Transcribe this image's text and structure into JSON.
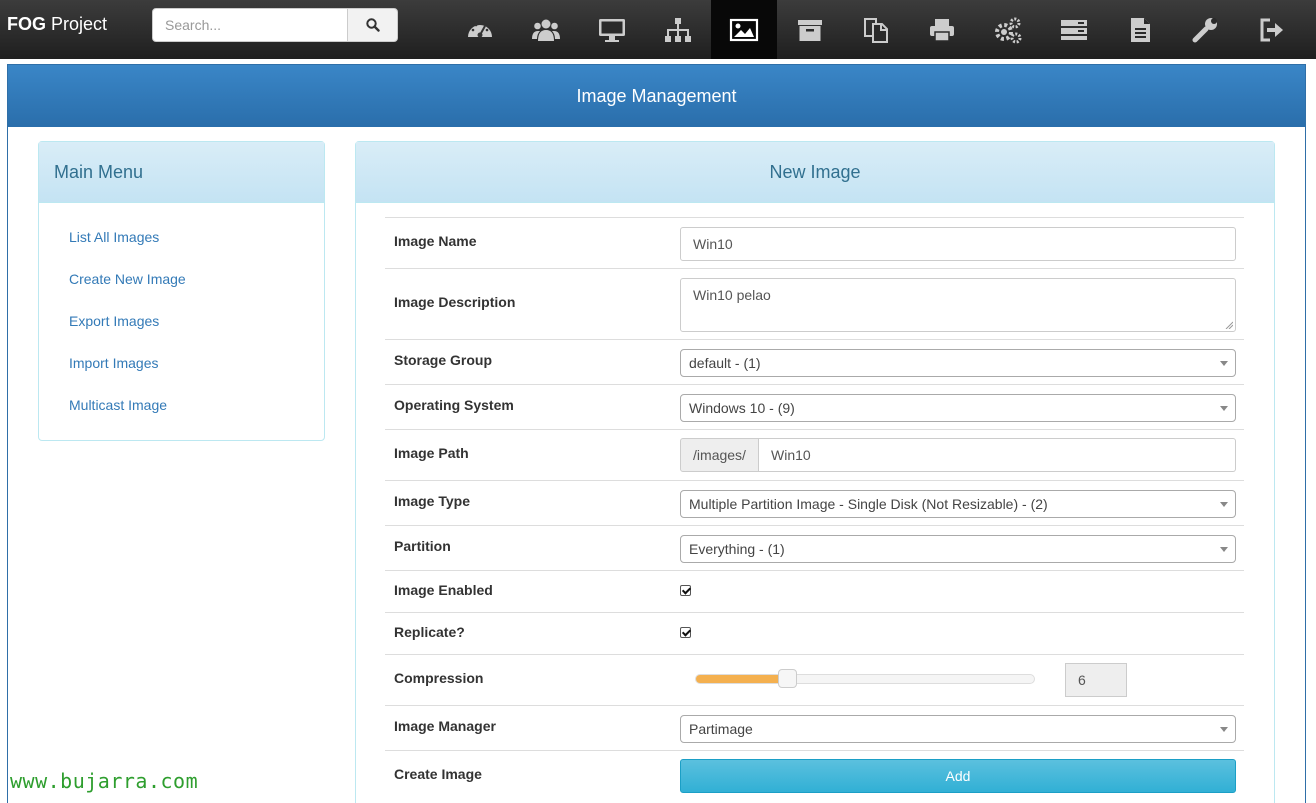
{
  "navbar": {
    "brand_bold": "FOG",
    "brand_rest": " Project",
    "search_placeholder": "Search...",
    "icons": [
      "dashboard-icon",
      "users-icon",
      "desktop-icon",
      "sitemap-icon",
      "image-icon",
      "archive-icon",
      "copy-icon",
      "print-icon",
      "cogs-icon",
      "server-icon",
      "file-icon",
      "wrench-icon",
      "logout-icon"
    ],
    "active_icon": "image-icon"
  },
  "page": {
    "title": "Image Management"
  },
  "menu": {
    "title": "Main Menu",
    "items": [
      "List All Images",
      "Create New Image",
      "Export Images",
      "Import Images",
      "Multicast Image"
    ]
  },
  "form": {
    "title": "New Image",
    "image_name": {
      "label": "Image Name",
      "value": "Win10"
    },
    "image_description": {
      "label": "Image Description",
      "value": "Win10 pelao"
    },
    "storage_group": {
      "label": "Storage Group",
      "value": "default - (1)"
    },
    "operating_system": {
      "label": "Operating System",
      "value": "Windows 10 - (9)"
    },
    "image_path": {
      "label": "Image Path",
      "prefix": "/images/",
      "value": "Win10"
    },
    "image_type": {
      "label": "Image Type",
      "value": "Multiple Partition Image - Single Disk (Not Resizable) - (2)"
    },
    "partition": {
      "label": "Partition",
      "value": "Everything - (1)"
    },
    "image_enabled": {
      "label": "Image Enabled",
      "checked": true
    },
    "replicate": {
      "label": "Replicate?",
      "checked": true
    },
    "compression": {
      "label": "Compression",
      "value": "6",
      "level_fraction": 0.27
    },
    "image_manager": {
      "label": "Image Manager",
      "value": "Partimage"
    },
    "create_image": {
      "label": "Create Image",
      "button": "Add"
    }
  },
  "colors": {
    "navbar": "#2b2b2b",
    "header": "#337ab7",
    "panel_head": "#d9edf7",
    "accent_button": "#5bc0de",
    "slider_fill": "#f4b04f",
    "watermark": "#2e9e2e"
  },
  "watermark": "www.bujarra.com"
}
